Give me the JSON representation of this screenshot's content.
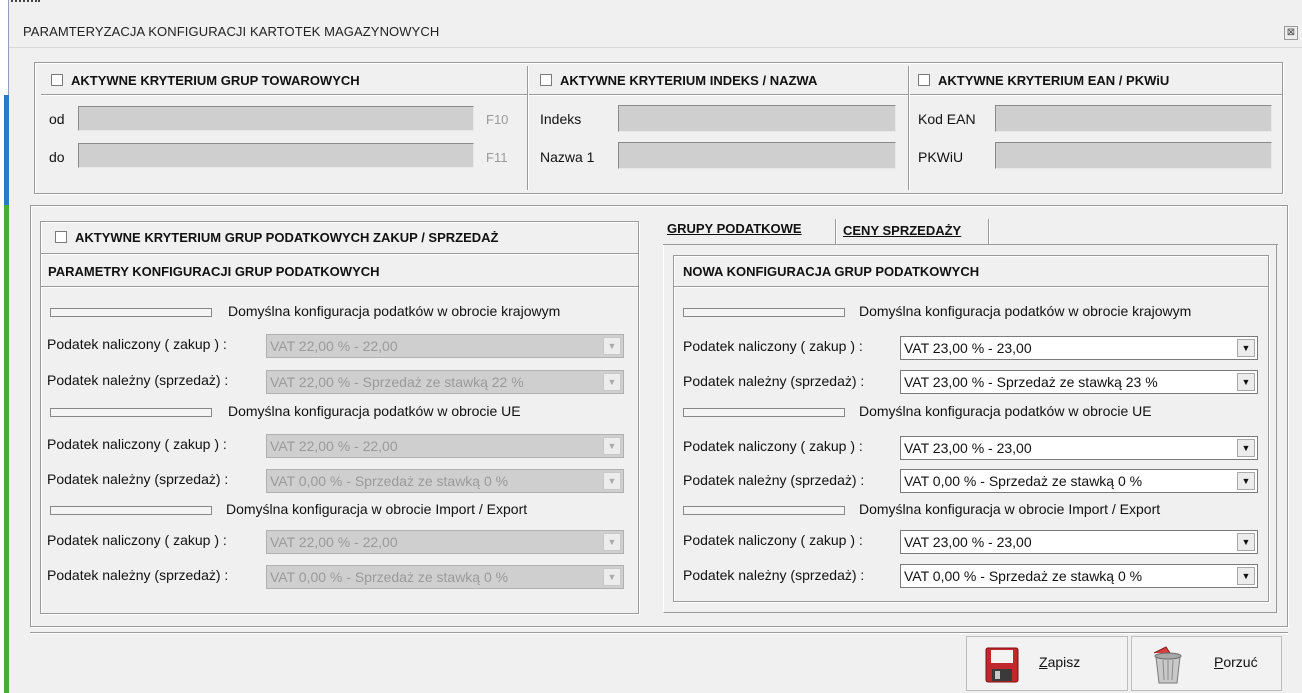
{
  "window": {
    "title": "PARAMTERYZACJA  KONFIGURACJI KARTOTEK MAGAZYNOWYCH",
    "close_glyph": "⊠"
  },
  "criteria": {
    "groups": {
      "label": "AKTYWNE KRYTERIUM GRUP TOWAROWYCH",
      "from_label": "od",
      "to_label": "do",
      "from_key": "F10",
      "to_key": "F11"
    },
    "index_name": {
      "label": "AKTYWNE KRYTERIUM  INDEKS / NAZWA",
      "index_label": "Indeks",
      "name_label": "Nazwa 1"
    },
    "ean": {
      "label": "AKTYWNE KRYTERIUM EAN / PKWiU",
      "ean_label": "Kod EAN",
      "pkwiu_label": "PKWiU"
    }
  },
  "left": {
    "checkbox_label": "AKTYWNE KRYTERIUM GRUP PODATKOWYCH ZAKUP / SPRZEDAŻ",
    "section_title": "PARAMETRY KONFIGURACJI GRUP PODATKOWYCH",
    "groups": [
      {
        "heading": "Domyślna konfiguracja podatków w obrocie krajowym",
        "rows": [
          {
            "label": "Podatek naliczony ( zakup ) :",
            "value": "VAT 22,00 % - 22,00"
          },
          {
            "label": "Podatek należny (sprzedaż) :",
            "value": "VAT 22,00 % - Sprzedaż ze stawką 22 %"
          }
        ]
      },
      {
        "heading": "Domyślna konfiguracja podatków w obrocie UE",
        "rows": [
          {
            "label": "Podatek naliczony ( zakup ) :",
            "value": "VAT 22,00 % - 22,00"
          },
          {
            "label": "Podatek należny (sprzedaż) :",
            "value": "VAT 0,00 % - Sprzedaż ze stawką 0 %"
          }
        ]
      },
      {
        "heading": "Domyślna konfiguracja w obrocie Import / Export",
        "rows": [
          {
            "label": "Podatek naliczony ( zakup ) :",
            "value": "VAT 22,00 % - 22,00"
          },
          {
            "label": "Podatek należny (sprzedaż) :",
            "value": "VAT 0,00 % - Sprzedaż ze stawką 0 %"
          }
        ]
      }
    ]
  },
  "tabs": [
    {
      "label": "GRUPY PODATKOWE",
      "active": true
    },
    {
      "label": "CENY SPRZEDAŻY",
      "active": false
    }
  ],
  "right": {
    "section_title": "NOWA KONFIGURACJA GRUP PODATKOWYCH",
    "groups": [
      {
        "heading": "Domyślna konfiguracja podatków w obrocie krajowym",
        "rows": [
          {
            "label": "Podatek naliczony ( zakup ) :",
            "value": "VAT 23,00 % - 23,00"
          },
          {
            "label": "Podatek należny (sprzedaż) :",
            "value": "VAT 23,00 % - Sprzedaż ze stawką 23 %"
          }
        ]
      },
      {
        "heading": "Domyślna konfiguracja podatków w obrocie UE",
        "rows": [
          {
            "label": "Podatek naliczony ( zakup ) :",
            "value": "VAT 23,00 % - 23,00"
          },
          {
            "label": "Podatek należny (sprzedaż) :",
            "value": "VAT 0,00 % - Sprzedaż ze stawką 0 %"
          }
        ]
      },
      {
        "heading": "Domyślna konfiguracja w obrocie Import / Export",
        "rows": [
          {
            "label": "Podatek naliczony ( zakup ) :",
            "value": "VAT 23,00 % - 23,00"
          },
          {
            "label": "Podatek należny (sprzedaż) :",
            "value": "VAT 0,00 % - Sprzedaż ze stawką 0 %"
          }
        ]
      }
    ]
  },
  "buttons": {
    "save": {
      "label_first": "Z",
      "label_rest": "apisz",
      "icon": "floppy-disk-icon"
    },
    "cancel": {
      "label_first": "P",
      "label_rest": "orzuć",
      "icon": "trash-bin-icon"
    }
  },
  "colors": {
    "disabled_field": "#cfcfcf",
    "save_icon": "#c0282d",
    "cancel_icon": "#b8b8b8"
  }
}
